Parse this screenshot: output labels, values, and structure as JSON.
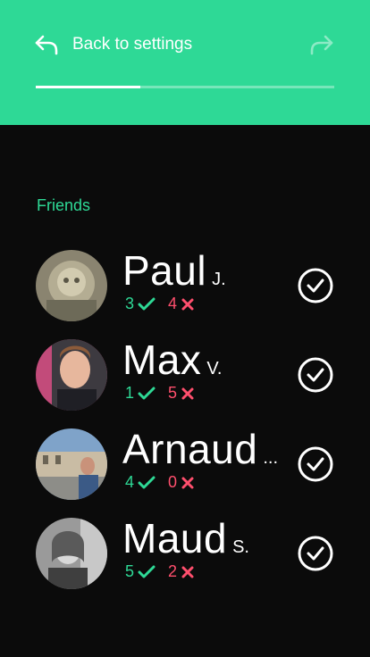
{
  "header": {
    "back_label": "Back to settings",
    "progress_fraction": 0.35,
    "back_icon": "back-arrow-icon",
    "forward_icon": "forward-arrow-icon"
  },
  "section": {
    "title": "Friends"
  },
  "colors": {
    "accent": "#2ed996",
    "negative": "#ff4f6d",
    "background": "#0b0b0b"
  },
  "friends": [
    {
      "first_name": "Paul",
      "initial": "J.",
      "yes_count": "3",
      "no_count": "4"
    },
    {
      "first_name": "Max",
      "initial": "V.",
      "yes_count": "1",
      "no_count": "5"
    },
    {
      "first_name": "Arnaud",
      "initial": "...",
      "yes_count": "4",
      "no_count": "0"
    },
    {
      "first_name": "Maud",
      "initial": "S.",
      "yes_count": "5",
      "no_count": "2"
    }
  ]
}
